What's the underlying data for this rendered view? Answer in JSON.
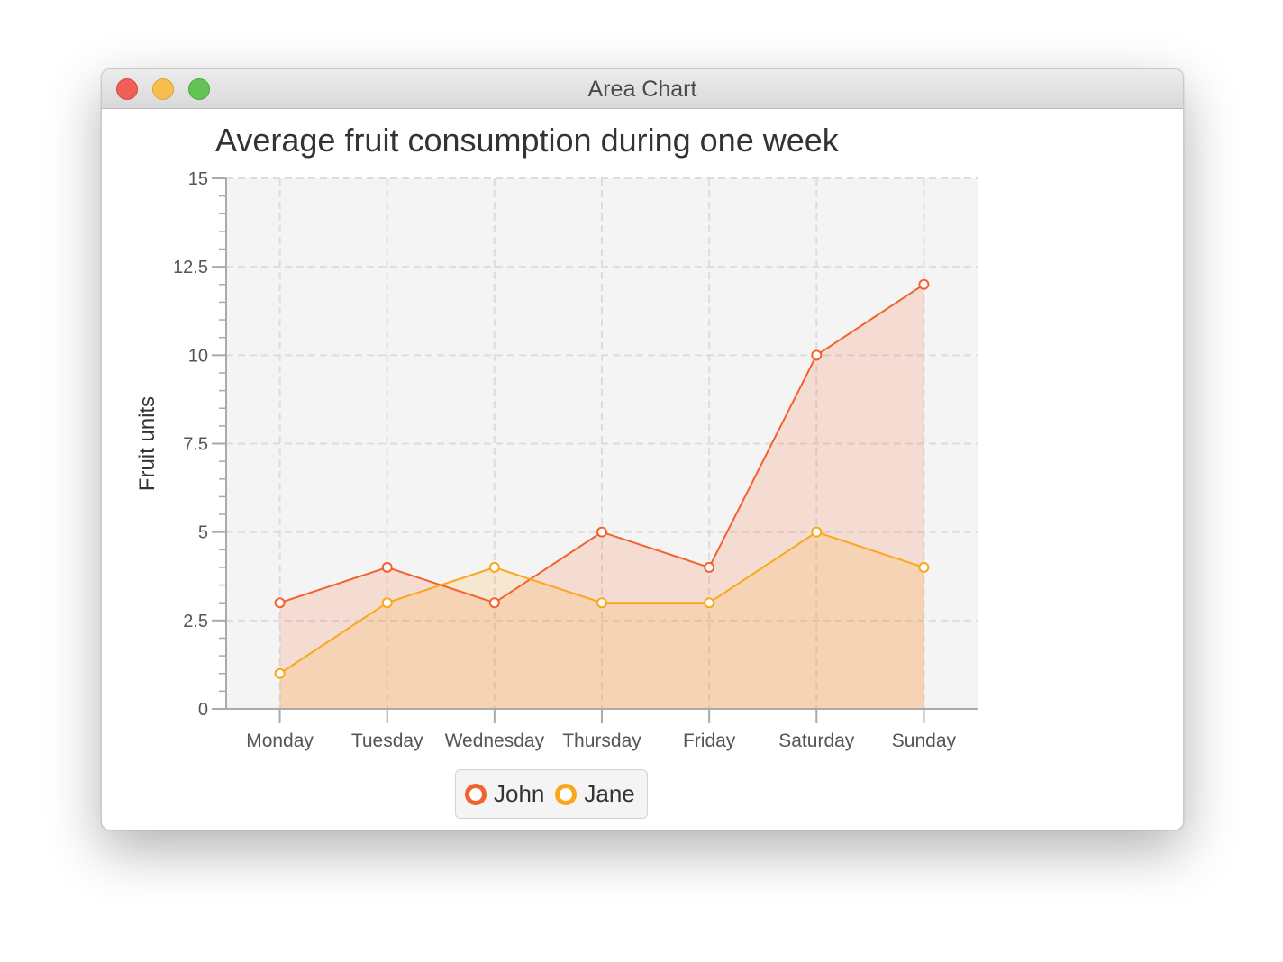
{
  "window": {
    "title": "Area Chart"
  },
  "chart_data": {
    "type": "area",
    "title": "Average fruit consumption during one week",
    "xlabel": "",
    "ylabel": "Fruit units",
    "categories": [
      "Monday",
      "Tuesday",
      "Wednesday",
      "Thursday",
      "Friday",
      "Saturday",
      "Sunday"
    ],
    "series": [
      {
        "name": "John",
        "values": [
          3,
          4,
          3,
          5,
          4,
          10,
          12
        ],
        "color": "#f3622d"
      },
      {
        "name": "Jane",
        "values": [
          1,
          3,
          4,
          3,
          3,
          5,
          4
        ],
        "color": "#fba71b"
      }
    ],
    "ylim": [
      0,
      15
    ],
    "yticks": [
      "0",
      "2.5",
      "5",
      "7.5",
      "10",
      "12.5",
      "15"
    ],
    "grid": true,
    "legend": "bottom",
    "plot_background": "#f4f4f4",
    "gridline_color": "#dddddd"
  }
}
